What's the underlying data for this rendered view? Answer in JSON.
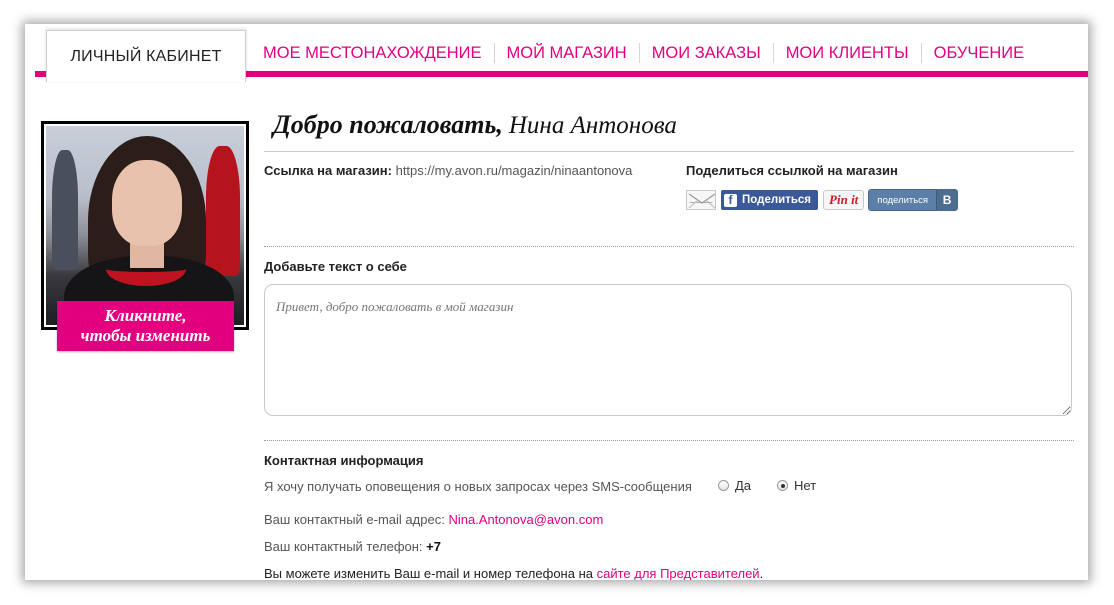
{
  "nav": {
    "active_tab": "ЛИЧНЫЙ КАБИНЕТ",
    "items": [
      "МОЕ МЕСТОНАХОЖДЕНИЕ",
      "МОЙ МАГАЗИН",
      "МОИ ЗАКАЗЫ",
      "МОИ КЛИЕНТЫ",
      "ОБУЧЕНИЕ"
    ]
  },
  "profile": {
    "change_photo_line1": "Кликните,",
    "change_photo_line2": "чтобы изменить"
  },
  "welcome": {
    "greeting": "Добро пожаловать,",
    "name": "Нина Антонова"
  },
  "store": {
    "link_label": "Ссылка на магазин:",
    "link_url": "https://my.avon.ru/magazin/ninaantonova",
    "share_title": "Поделиться ссылкой на магазин",
    "facebook_label": "Поделиться",
    "pinterest_label": "Pin it",
    "vk_label": "поделиться",
    "vk_badge": "В"
  },
  "about": {
    "title": "Добавьте текст о себе",
    "placeholder": "Привет, добро пожаловать в мой магазин"
  },
  "contact": {
    "title": "Контактная информация",
    "sms_question": "Я хочу получать оповещения о новых запросах через SMS-сообщения",
    "sms_yes": "Да",
    "sms_no": "Нет",
    "sms_selected": "Нет",
    "email_label": "Ваш контактный e-mail адрес:",
    "email_value": "Nina.Antonova@avon.com",
    "phone_label": "Ваш контактный телефон:",
    "phone_value": "+7",
    "change_text": "Вы можете изменить Ваш e-mail и номер телефона на",
    "change_link": "сайте для Представителей",
    "change_end": "."
  },
  "colors": {
    "accent": "#e3007f",
    "facebook": "#3b5998",
    "vk": "#5b7fa6",
    "pinterest": "#cb2027"
  }
}
